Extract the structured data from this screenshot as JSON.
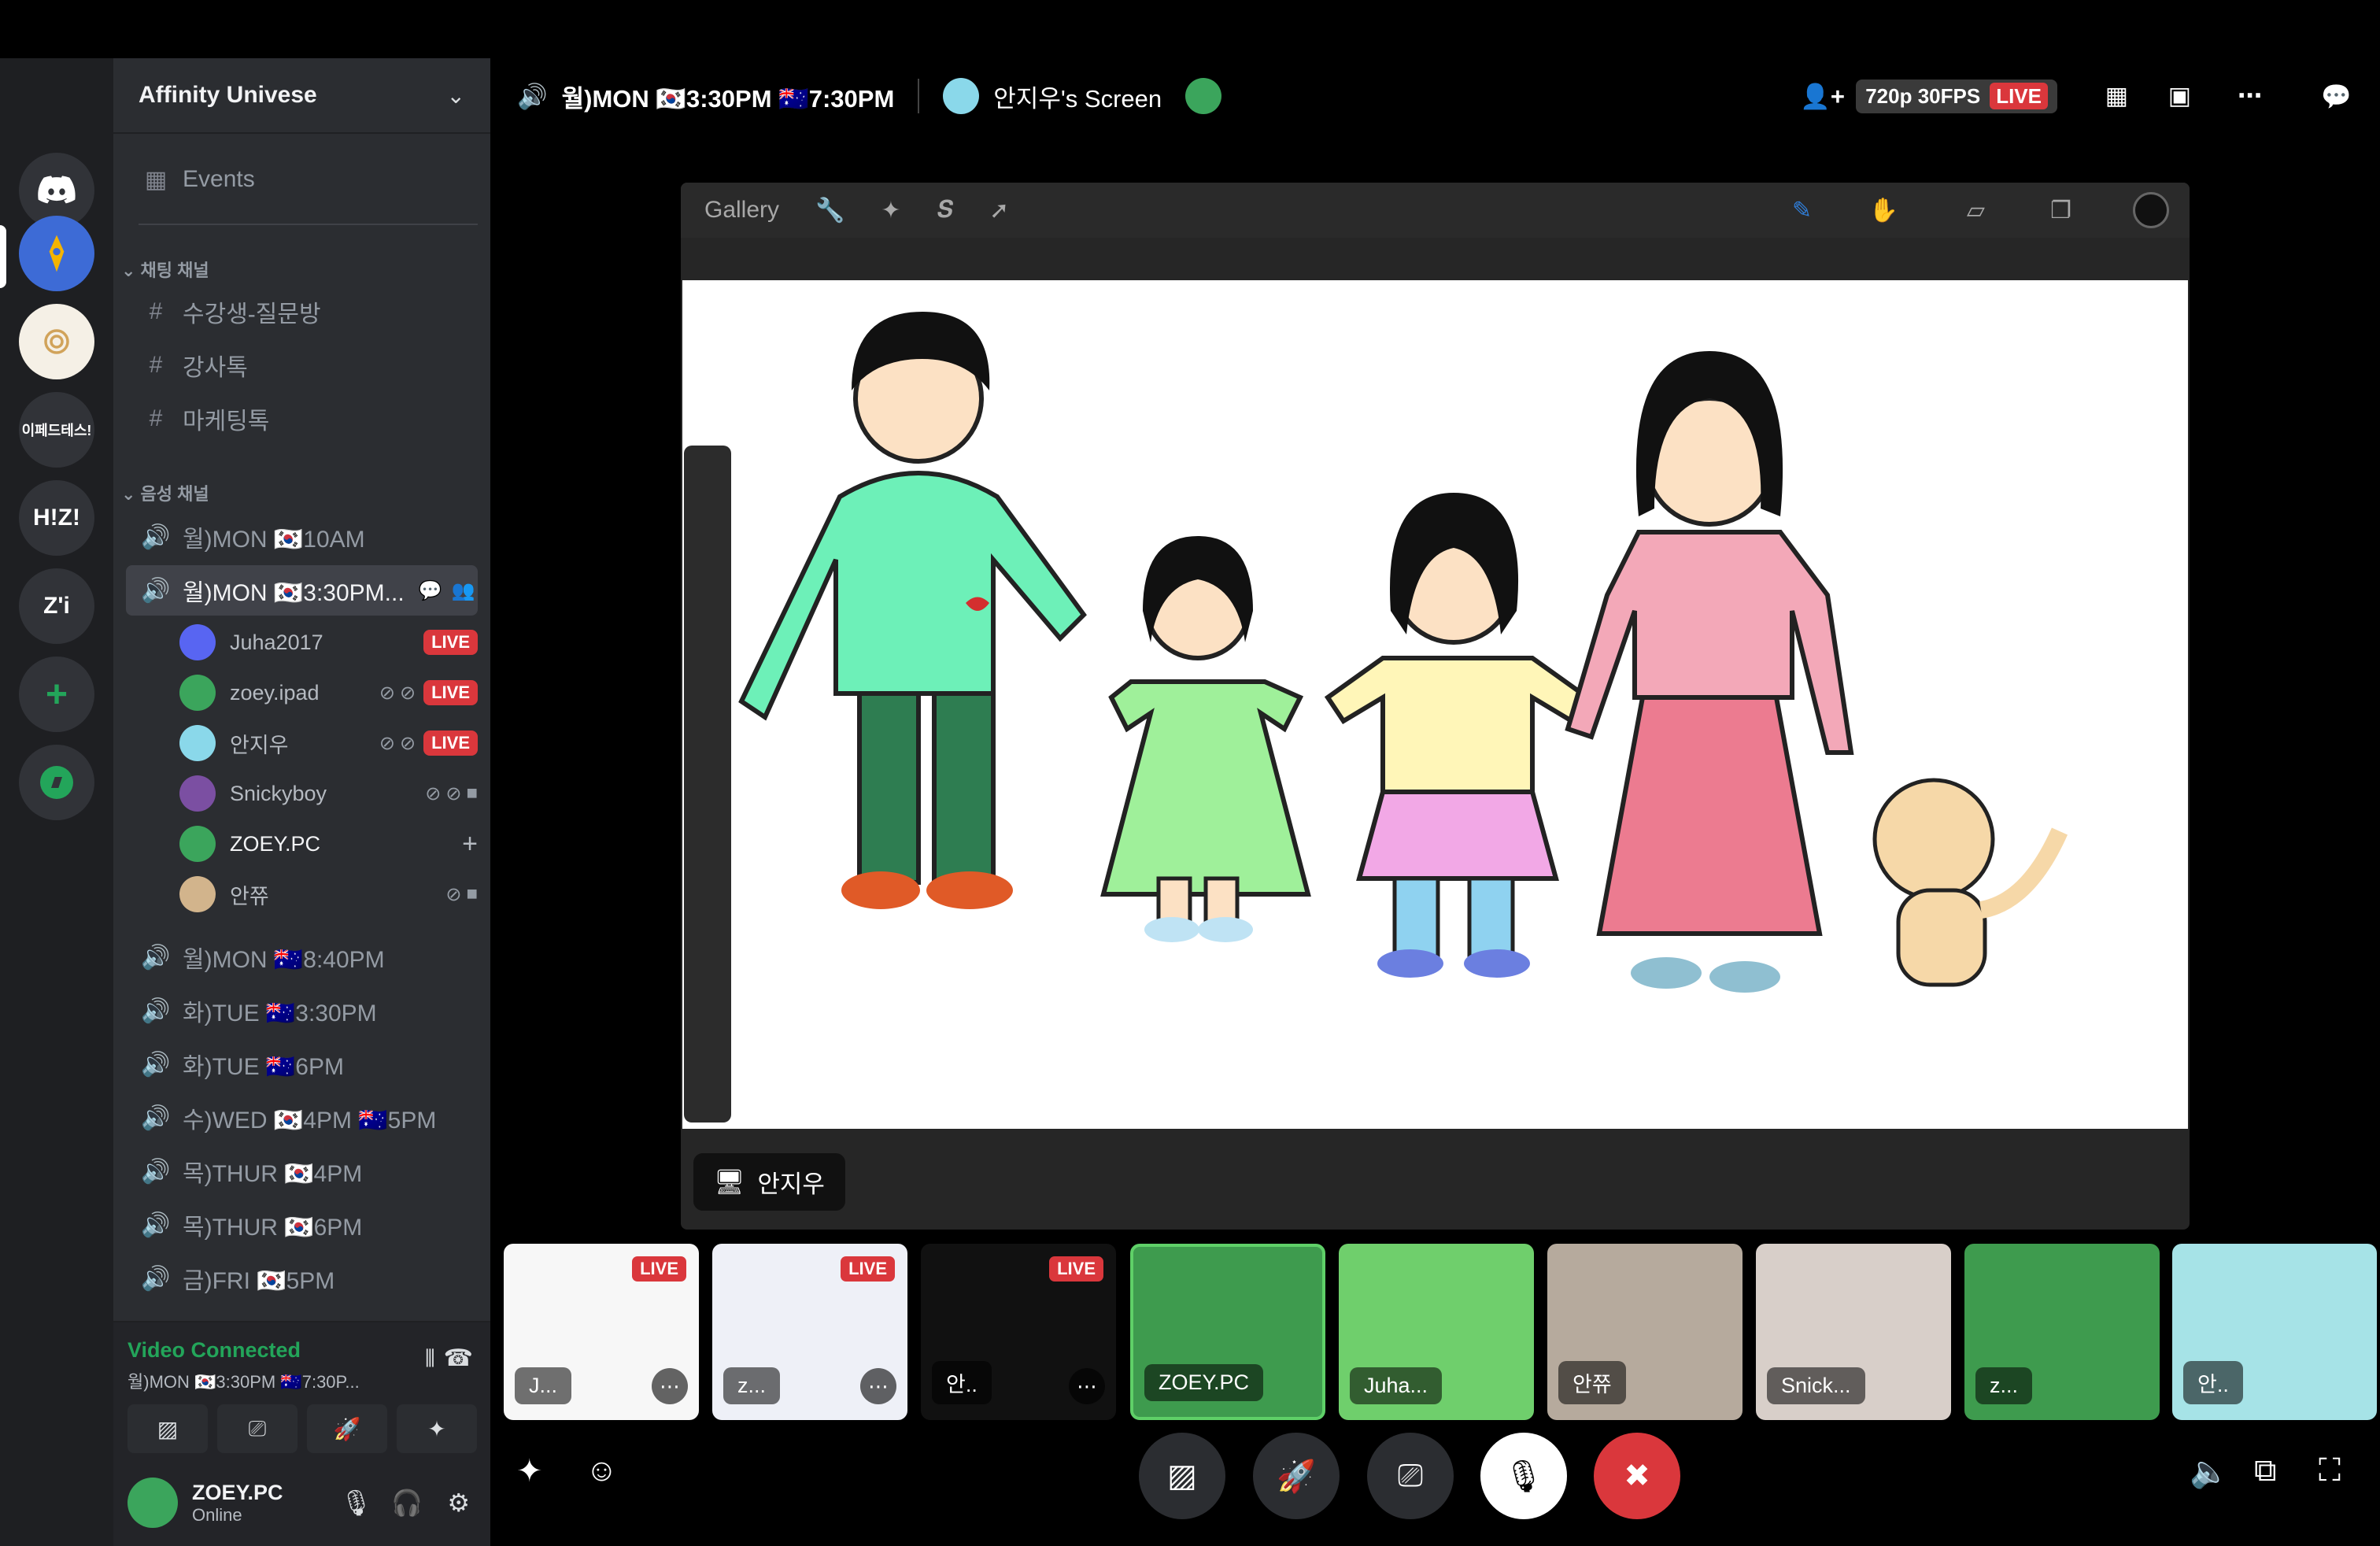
{
  "server": {
    "name": "Affinity Univese",
    "rail": [
      "H!Z!",
      "Z'i",
      "이페드테스!"
    ]
  },
  "sidebar": {
    "events_label": "Events",
    "text_category": "채팅 채널",
    "text_channels": [
      "수강생-질문방",
      "강사톡",
      "마케팅톡"
    ],
    "voice_category": "음성 채널",
    "voice_channels": [
      "월)MON 🇰🇷10AM",
      "월)MON 🇰🇷3:30PM...",
      "월)MON 🇦🇺8:40PM",
      "화)TUE 🇦🇺3:30PM",
      "화)TUE 🇦🇺6PM",
      "수)WED 🇰🇷4PM 🇦🇺5PM",
      "목)THUR 🇰🇷4PM",
      "목)THUR 🇰🇷6PM",
      "금)FRI 🇰🇷5PM"
    ],
    "members": [
      {
        "name": "Juha2017",
        "live": "LIVE",
        "color": "#5865f2"
      },
      {
        "name": "zoey.ipad",
        "live": "LIVE",
        "color": "#3ba55c"
      },
      {
        "name": "안지우",
        "live": "LIVE",
        "color": "#8ad8ea"
      },
      {
        "name": "Snickyboy",
        "live": "",
        "color": "#7b4fa2"
      },
      {
        "name": "ZOEY.PC",
        "live": "",
        "color": "#3ba55c"
      },
      {
        "name": "안쮸",
        "live": "",
        "color": "#d2b48c"
      }
    ]
  },
  "voice_panel": {
    "status": "Video Connected",
    "channel": "월)MON 🇰🇷3:30PM 🇦🇺7:30P..."
  },
  "user": {
    "name": "ZOEY.PC",
    "status": "Online"
  },
  "topbar": {
    "channel": "월)MON 🇰🇷3:30PM 🇦🇺7:30PM",
    "screen": "안지우's Screen",
    "quality": "720p 30FPS",
    "live": "LIVE"
  },
  "procreate": {
    "gallery": "Gallery"
  },
  "stream_label": "안지우",
  "thumbnails": [
    {
      "name": "J...",
      "live": "LIVE"
    },
    {
      "name": "z...",
      "live": "LIVE"
    },
    {
      "name": "안..",
      "live": "LIVE"
    },
    {
      "name": "ZOEY.PC",
      "live": ""
    },
    {
      "name": "Juha...",
      "live": ""
    },
    {
      "name": "안쮸",
      "live": ""
    },
    {
      "name": "Snick...",
      "live": ""
    },
    {
      "name": "z...",
      "live": ""
    },
    {
      "name": "안..",
      "live": ""
    }
  ]
}
